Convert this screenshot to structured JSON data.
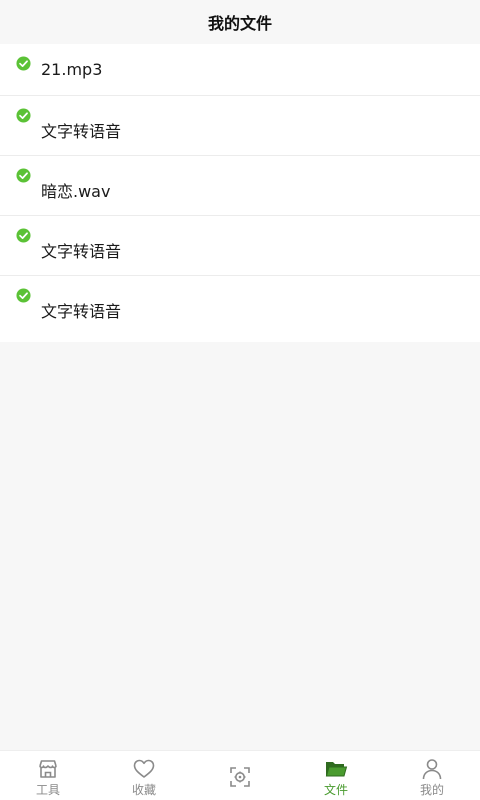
{
  "header": {
    "title": "我的文件"
  },
  "files": [
    {
      "name": "21.mp3",
      "status": "done"
    },
    {
      "name": "文字转语音",
      "status": "done"
    },
    {
      "name": "暗恋.wav",
      "status": "done"
    },
    {
      "name": "文字转语音",
      "status": "done"
    },
    {
      "name": "文字转语音",
      "status": "done"
    }
  ],
  "tabbar": {
    "tabs": [
      {
        "label": "工具",
        "icon": "store-icon",
        "active": false
      },
      {
        "label": "收藏",
        "icon": "heart-icon",
        "active": false
      },
      {
        "label": "",
        "icon": "scan-icon",
        "active": false
      },
      {
        "label": "文件",
        "icon": "folder-icon",
        "active": true
      },
      {
        "label": "我的",
        "icon": "user-icon",
        "active": false
      }
    ]
  },
  "colors": {
    "accent": "#4a9b2f",
    "check": "#5bc236",
    "background": "#f7f7f7",
    "inactive_tab": "#8a8a8a"
  }
}
